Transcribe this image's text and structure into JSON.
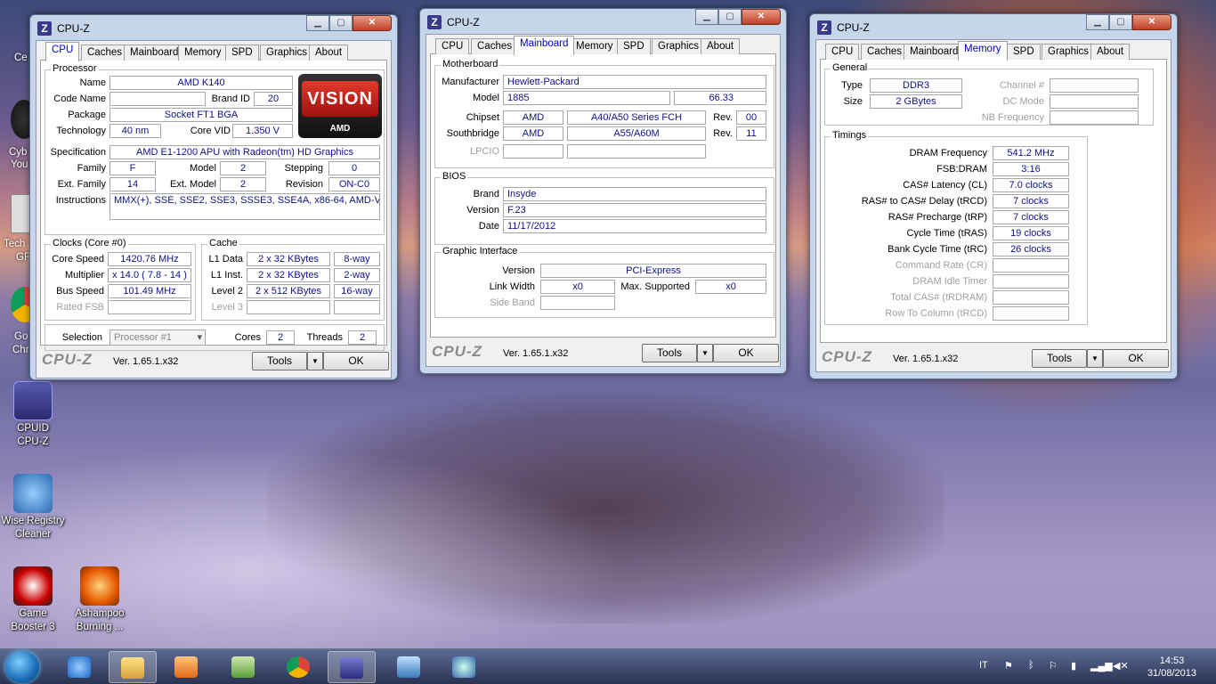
{
  "desktop": {
    "icons": [
      {
        "label1": "CPUID",
        "label2": "CPU-Z"
      },
      {
        "label1": "Wise Registry",
        "label2": "Cleaner"
      },
      {
        "label1": "Game",
        "label2": "Booster 3"
      },
      {
        "label1": "Ashampoo",
        "label2": "Burning ..."
      }
    ],
    "cut_labels": [
      "Ce",
      "Cyb",
      "You",
      "Tech",
      "GF",
      "Go",
      "Chr"
    ]
  },
  "windows": [
    {
      "title": "CPU-Z",
      "tabs": [
        "CPU",
        "Caches",
        "Mainboard",
        "Memory",
        "SPD",
        "Graphics",
        "About"
      ],
      "active": "CPU"
    },
    {
      "title": "CPU-Z",
      "tabs": [
        "CPU",
        "Caches",
        "Mainboard",
        "Memory",
        "SPD",
        "Graphics",
        "About"
      ],
      "active": "Mainboard"
    },
    {
      "title": "CPU-Z",
      "tabs": [
        "CPU",
        "Caches",
        "Mainboard",
        "Memory",
        "SPD",
        "Graphics",
        "About"
      ],
      "active": "Memory"
    }
  ],
  "footer": {
    "brand": "CPU-Z",
    "version": "Ver. 1.65.1.x32",
    "tools": "Tools",
    "ok": "OK"
  },
  "cpu": {
    "group_processor": "Processor",
    "name_lbl": "Name",
    "name": "AMD K140",
    "codename_lbl": "Code Name",
    "codename": "",
    "brandid_lbl": "Brand ID",
    "brandid": "20",
    "package_lbl": "Package",
    "package": "Socket FT1 BGA",
    "tech_lbl": "Technology",
    "tech": "40 nm",
    "vid_lbl": "Core VID",
    "vid": "1.350 V",
    "spec_lbl": "Specification",
    "spec": "AMD E1-1200 APU with Radeon(tm) HD Graphics",
    "family_lbl": "Family",
    "family": "F",
    "model_lbl": "Model",
    "model": "2",
    "stepping_lbl": "Stepping",
    "stepping": "0",
    "extfamily_lbl": "Ext. Family",
    "extfamily": "14",
    "extmodel_lbl": "Ext. Model",
    "extmodel": "2",
    "revision_lbl": "Revision",
    "revision": "ON-C0",
    "instr_lbl": "Instructions",
    "instr": "MMX(+), SSE, SSE2, SSE3, SSSE3, SSE4A, x86-64, AMD-V",
    "logo_main": "VISION",
    "logo_sub": "AMD",
    "group_clocks": "Clocks (Core #0)",
    "corespeed_lbl": "Core Speed",
    "corespeed": "1420.76 MHz",
    "mult_lbl": "Multiplier",
    "mult": "x 14.0 ( 7.8 - 14 )",
    "bus_lbl": "Bus Speed",
    "bus": "101.49 MHz",
    "fsb_lbl": "Rated FSB",
    "fsb": "",
    "group_cache": "Cache",
    "l1d_lbl": "L1 Data",
    "l1d": "2 x 32 KBytes",
    "l1d_way": "8-way",
    "l1i_lbl": "L1 Inst.",
    "l1i": "2 x 32 KBytes",
    "l1i_way": "2-way",
    "l2_lbl": "Level 2",
    "l2": "2 x 512 KBytes",
    "l2_way": "16-way",
    "l3_lbl": "Level 3",
    "l3": "",
    "l3_way": "",
    "selection_lbl": "Selection",
    "selection": "Processor #1",
    "cores_lbl": "Cores",
    "cores": "2",
    "threads_lbl": "Threads",
    "threads": "2"
  },
  "mainboard": {
    "group_mb": "Motherboard",
    "manu_lbl": "Manufacturer",
    "manu": "Hewlett-Packard",
    "model_lbl": "Model",
    "model": "1885",
    "model_rev": "66.33",
    "chipset_lbl": "Chipset",
    "chipset_v": "AMD",
    "chipset_m": "A40/A50 Series FCH",
    "chipset_rev_lbl": "Rev.",
    "chipset_rev": "00",
    "south_lbl": "Southbridge",
    "south_v": "AMD",
    "south_m": "A55/A60M",
    "south_rev_lbl": "Rev.",
    "south_rev": "11",
    "lpcio_lbl": "LPCIO",
    "group_bios": "BIOS",
    "brand_lbl": "Brand",
    "brand": "Insyde",
    "version_lbl": "Version",
    "version": "F.23",
    "date_lbl": "Date",
    "date": "11/17/2012",
    "group_gi": "Graphic Interface",
    "giver_lbl": "Version",
    "giver": "PCI-Express",
    "link_lbl": "Link Width",
    "link": "x0",
    "maxsup_lbl": "Max. Supported",
    "maxsup": "x0",
    "side_lbl": "Side Band"
  },
  "memory": {
    "group_general": "General",
    "type_lbl": "Type",
    "type": "DDR3",
    "size_lbl": "Size",
    "size": "2 GBytes",
    "channel_lbl": "Channel #",
    "dcmode_lbl": "DC Mode",
    "nbfreq_lbl": "NB Frequency",
    "group_timings": "Timings",
    "t": [
      {
        "l": "DRAM Frequency",
        "v": "541.2 MHz",
        "dis": false
      },
      {
        "l": "FSB:DRAM",
        "v": "3:16",
        "dis": false
      },
      {
        "l": "CAS# Latency (CL)",
        "v": "7.0 clocks",
        "dis": false
      },
      {
        "l": "RAS# to CAS# Delay (tRCD)",
        "v": "7 clocks",
        "dis": false
      },
      {
        "l": "RAS# Precharge (tRP)",
        "v": "7 clocks",
        "dis": false
      },
      {
        "l": "Cycle Time (tRAS)",
        "v": "19 clocks",
        "dis": false
      },
      {
        "l": "Bank Cycle Time (tRC)",
        "v": "26 clocks",
        "dis": false
      },
      {
        "l": "Command Rate (CR)",
        "v": "",
        "dis": true
      },
      {
        "l": "DRAM Idle Timer",
        "v": "",
        "dis": true
      },
      {
        "l": "Total CAS# (tRDRAM)",
        "v": "",
        "dis": true
      },
      {
        "l": "Row To Column (tRCD)",
        "v": "",
        "dis": true
      }
    ]
  },
  "taskbar": {
    "lang": "IT",
    "time": "14:53",
    "date": "31/08/2013"
  }
}
